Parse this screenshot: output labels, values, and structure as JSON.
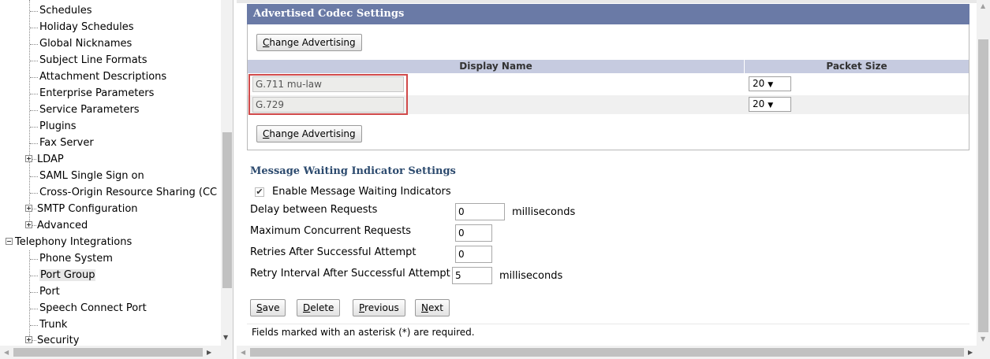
{
  "tree": {
    "items": [
      {
        "label": "Schedules"
      },
      {
        "label": "Holiday Schedules"
      },
      {
        "label": "Global Nicknames"
      },
      {
        "label": "Subject Line Formats"
      },
      {
        "label": "Attachment Descriptions"
      },
      {
        "label": "Enterprise Parameters"
      },
      {
        "label": "Service Parameters"
      },
      {
        "label": "Plugins"
      },
      {
        "label": "Fax Server"
      },
      {
        "label": "LDAP"
      },
      {
        "label": "SAML Single Sign on"
      },
      {
        "label": "Cross-Origin Resource Sharing (CC"
      },
      {
        "label": "SMTP Configuration"
      },
      {
        "label": "Advanced"
      },
      {
        "label": "Telephony Integrations"
      },
      {
        "label": "Phone System"
      },
      {
        "label": "Port Group"
      },
      {
        "label": "Port"
      },
      {
        "label": "Speech Connect Port"
      },
      {
        "label": "Trunk"
      },
      {
        "label": "Security"
      }
    ]
  },
  "codec": {
    "header": "Advertised Codec Settings",
    "change_btn_prefix": "C",
    "change_btn_rest": "hange Advertising",
    "col_display_name": "Display Name",
    "col_packet_size": "Packet Size",
    "rows": [
      {
        "name": "G.711 mu-law",
        "packet_size": "20"
      },
      {
        "name": "G.729",
        "packet_size": "20"
      }
    ]
  },
  "mwi": {
    "title": "Message Waiting Indicator Settings",
    "enable_label": "Enable Message Waiting Indicators",
    "enabled": true,
    "fields": [
      {
        "label": "Delay between Requests",
        "value": "0",
        "unit": "milliseconds"
      },
      {
        "label": "Maximum Concurrent Requests",
        "value": "0",
        "unit": ""
      },
      {
        "label": "Retries After Successful Attempt",
        "value": "0",
        "unit": ""
      },
      {
        "label": "Retry Interval After Successful Attempt",
        "value": "5",
        "unit": "milliseconds"
      }
    ]
  },
  "actions": {
    "save": {
      "ul": "S",
      "rest": "ave"
    },
    "delete": {
      "ul": "D",
      "rest": "elete"
    },
    "previous": {
      "ul": "P",
      "rest": "revious"
    },
    "next": {
      "ul": "N",
      "rest": "ext"
    }
  },
  "footer_note": "Fields marked with an asterisk (*) are required.",
  "colors": {
    "header_bg": "#6a7aa6",
    "table_header_bg": "#c6cbe0",
    "highlight_border": "#d04a4a",
    "section_title": "#2c4a6e"
  }
}
